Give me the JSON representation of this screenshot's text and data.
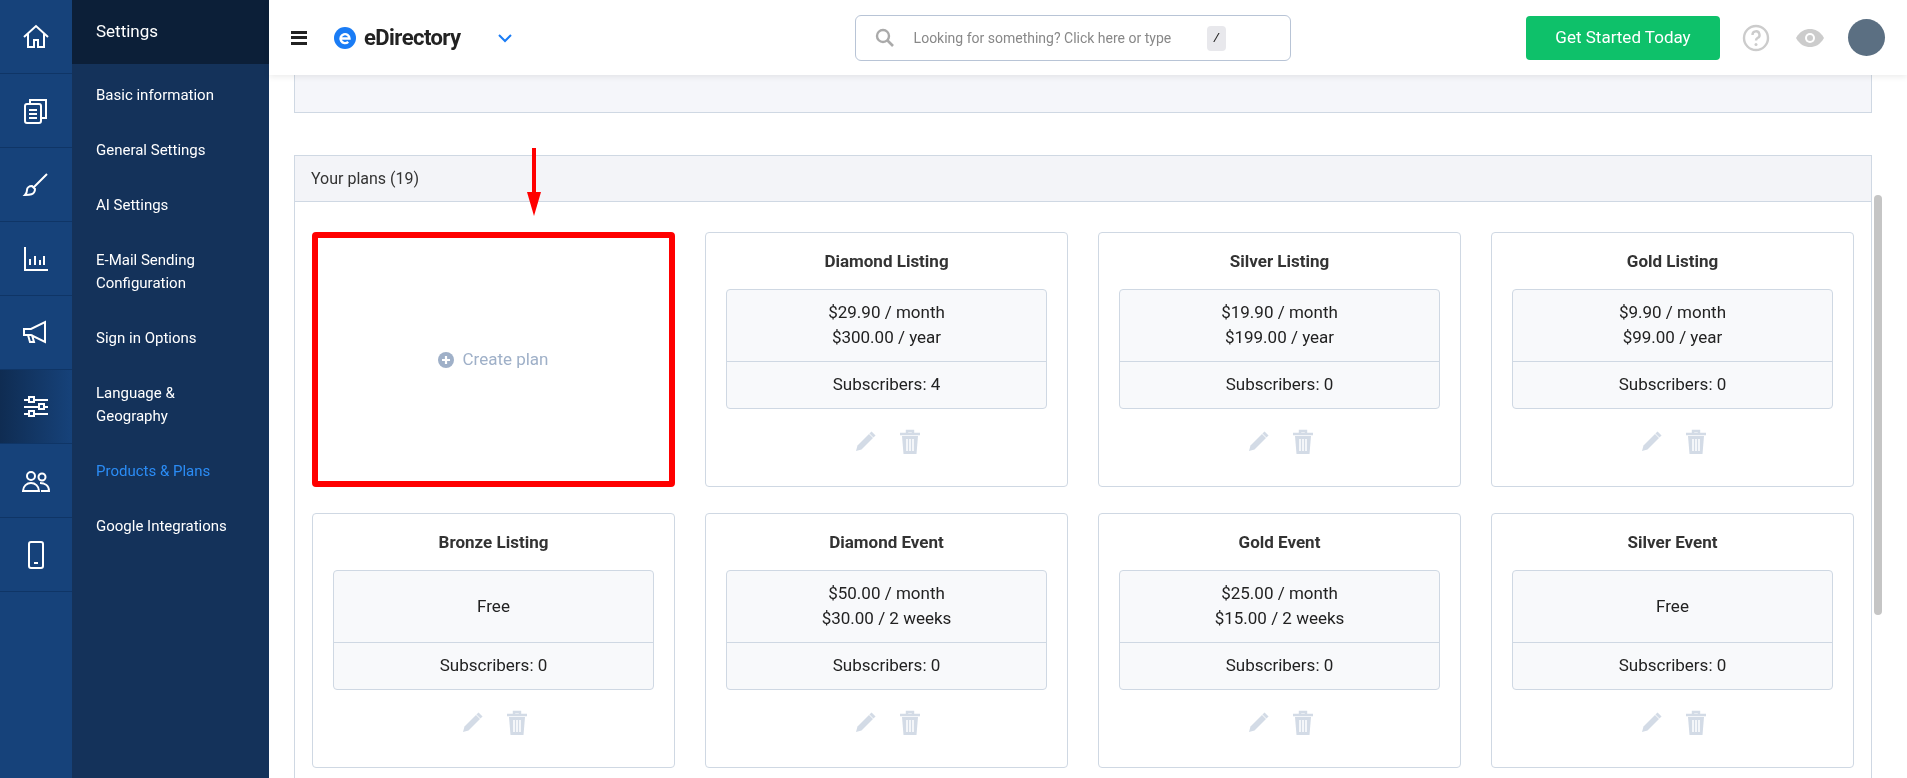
{
  "icon_rail": [
    {
      "selected": false
    },
    {
      "selected": false
    },
    {
      "selected": false
    },
    {
      "selected": false
    },
    {
      "selected": false
    },
    {
      "selected": true
    },
    {
      "selected": false
    },
    {
      "selected": false
    }
  ],
  "sidebar": {
    "title": "Settings",
    "items": [
      {
        "label": "Basic information",
        "selected": false
      },
      {
        "label": "General Settings",
        "selected": false
      },
      {
        "label": "AI Settings",
        "selected": false
      },
      {
        "label": "E-Mail Sending Configuration",
        "selected": false
      },
      {
        "label": "Sign in Options",
        "selected": false
      },
      {
        "label": "Language & Geography",
        "selected": false
      },
      {
        "label": "Products & Plans",
        "selected": true
      },
      {
        "label": "Google Integrations",
        "selected": false
      }
    ]
  },
  "topbar": {
    "brand": "eDirectory",
    "search": {
      "placeholder": "Looking for something? Click here or type",
      "shortcut": "/"
    },
    "cta": "Get Started Today"
  },
  "plans_panel": {
    "title": "Your plans (19)",
    "create": {
      "label": "Create plan",
      "highlighted": true
    },
    "plans": [
      {
        "name": "Diamond Listing",
        "prices": [
          "$29.90 / month",
          "$300.00 / year"
        ],
        "subscribers": "Subscribers: 4"
      },
      {
        "name": "Silver Listing",
        "prices": [
          "$19.90 / month",
          "$199.00 / year"
        ],
        "subscribers": "Subscribers: 0"
      },
      {
        "name": "Gold Listing",
        "prices": [
          "$9.90 / month",
          "$99.00 / year"
        ],
        "subscribers": "Subscribers: 0"
      },
      {
        "name": "Bronze Listing",
        "prices": [
          "Free"
        ],
        "subscribers": "Subscribers: 0"
      },
      {
        "name": "Diamond Event",
        "prices": [
          "$50.00 / month",
          "$30.00 / 2 weeks"
        ],
        "subscribers": "Subscribers: 0"
      },
      {
        "name": "Gold Event",
        "prices": [
          "$25.00 / month",
          "$15.00 / 2 weeks"
        ],
        "subscribers": "Subscribers: 0"
      },
      {
        "name": "Silver Event",
        "prices": [
          "Free"
        ],
        "subscribers": "Subscribers: 0"
      }
    ]
  }
}
